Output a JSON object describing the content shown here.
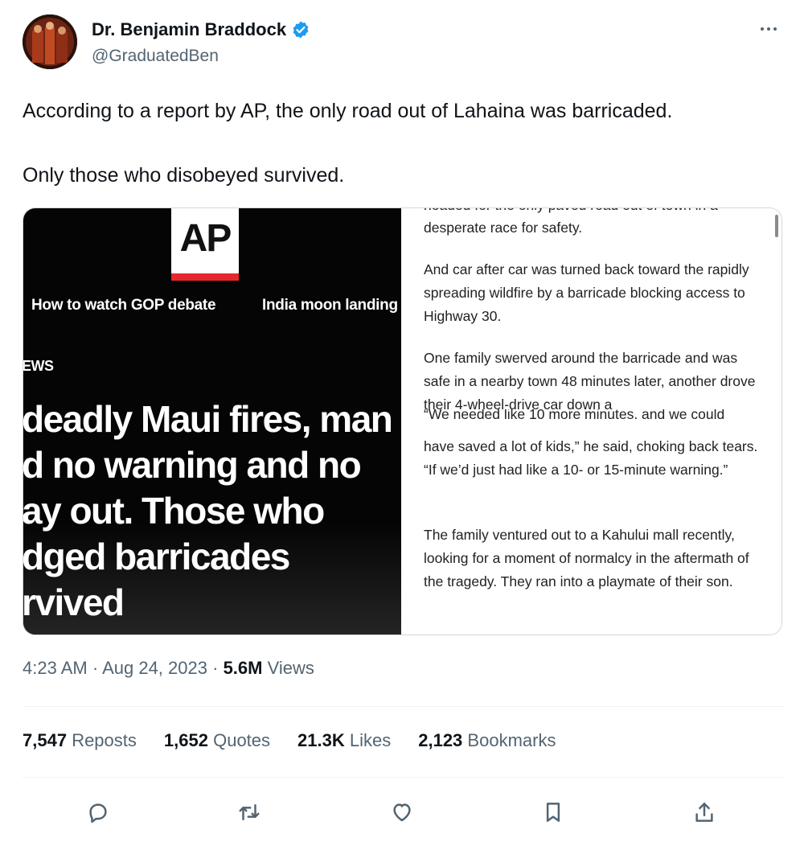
{
  "author": {
    "name": "Dr. Benjamin Braddock",
    "handle": "@GraduatedBen",
    "verified": true,
    "verified_color": "#1d9bf0"
  },
  "tweet": {
    "paragraphs": [
      "According to a report by AP, the only road out of Lahaina was barricaded.",
      "Only those who disobeyed survived."
    ]
  },
  "media": {
    "left": {
      "logo_text": "AP",
      "logo_accent_color": "#e4282c",
      "nav_links": [
        "How to watch GOP debate",
        "India moon landing"
      ],
      "section_label": "EWS",
      "headline_lines": [
        "deadly Maui fires, man",
        "d no warning and no",
        "ay out. Those who",
        "dged barricades",
        "rvived"
      ]
    },
    "right": {
      "cut_top_line": "headed for the only paved road out of town in a",
      "paragraphs": [
        "desperate race for safety.",
        "And car after car was turned back toward the rapidly spreading wildfire by a barricade blocking access to Highway 30.",
        "One family swerved around the barricade and was safe in a nearby town 48 minutes later, another drove their 4-wheel-drive car down a",
        "have saved a lot of kids,” he said, choking back tears. “If we’d just had like a 10- or 15-minute warning.”",
        "The family ventured out to a Kahului mall recently, looking for a moment of normalcy in the aftermath of the tragedy. They ran into a playmate of their son."
      ],
      "cut_mid_line": "“We needed like 10 more minutes, and we could"
    }
  },
  "meta": {
    "time": "4:23 AM",
    "separator": "·",
    "date": "Aug 24, 2023",
    "views_count": "5.6M",
    "views_label": "Views"
  },
  "stats": [
    {
      "count": "7,547",
      "label": "Reposts"
    },
    {
      "count": "1,652",
      "label": "Quotes"
    },
    {
      "count": "21.3K",
      "label": "Likes"
    },
    {
      "count": "2,123",
      "label": "Bookmarks"
    }
  ],
  "actions": [
    {
      "icon": "reply-icon"
    },
    {
      "icon": "repost-icon"
    },
    {
      "icon": "like-icon"
    },
    {
      "icon": "bookmark-icon"
    },
    {
      "icon": "share-icon"
    }
  ]
}
